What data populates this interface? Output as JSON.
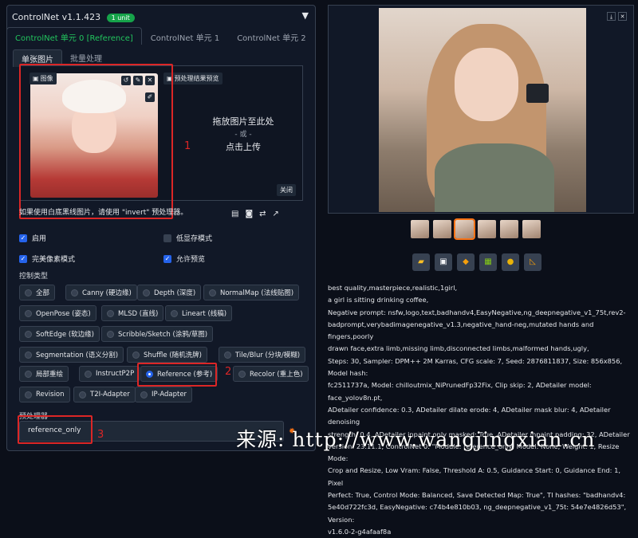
{
  "controlnet": {
    "header_title": "ControlNet v1.1.423",
    "unit_badge": "1 unit",
    "collapse_icon": "▼",
    "tabs": [
      "ControlNet 单元 0 [Reference]",
      "ControlNet 单元 1",
      "ControlNet 单元 2"
    ],
    "subtabs": [
      "单张图片",
      "批量处理"
    ],
    "image_chip_label": "图像",
    "preview_chip_label": "预处理结果预览",
    "drop_line1": "拖放图片至此处",
    "drop_or": "- 或 -",
    "drop_line2": "点击上传",
    "close_label": "关闭",
    "hint": "如果使用白底黑线图片，请使用 \"invert\" 预处理器。",
    "checkboxes": {
      "enable": "启用",
      "low_vram": "低显存模式",
      "pixel_perfect": "完美像素模式",
      "allow_preview": "允许预览"
    },
    "control_type_label": "控制类型",
    "control_types": [
      "全部",
      "Canny (硬边缘)",
      "Depth (深度)",
      "NormalMap (法线贴图)",
      "OpenPose (姿态)",
      "MLSD (直线)",
      "Lineart (线稿)",
      "SoftEdge (软边缘)",
      "Scribble/Sketch (涂鸦/草图)",
      "Segmentation (语义分割)",
      "Shuffle (随机洗牌)",
      "Tile/Blur (分块/模糊)",
      "局部重绘",
      "InstructP2P",
      "Reference (参考)",
      "Recolor (重上色)",
      "Revision",
      "T2I-Adapter",
      "IP-Adapter"
    ],
    "selected_control_type": "Reference (参考)",
    "preprocessor_label": "预处理器",
    "preprocessor_value": "reference_only",
    "annotations": [
      "1",
      "2",
      "3"
    ]
  },
  "output": {
    "info_lines": [
      "best quality,masterpiece,realistic,1girl,",
      "a girl is sitting drinking coffee,",
      "Negative prompt: nsfw,logo,text,badhandv4,EasyNegative,ng_deepnegative_v1_75t,rev2-",
      "badprompt,verybadimagenegative_v1.3,negative_hand-neg,mutated hands and fingers,poorly",
      "drawn face,extra limb,missing limb,disconnected limbs,malformed hands,ugly,",
      "Steps: 30, Sampler: DPM++ 2M Karras, CFG scale: 7, Seed: 2876811837, Size: 856x856, Model hash:",
      "fc2511737a, Model: chilloutmix_NiPrunedFp32Fix, Clip skip: 2, ADetailer model: face_yolov8n.pt,",
      "ADetailer confidence: 0.3, ADetailer dilate erode: 4, ADetailer mask blur: 4, ADetailer denoising",
      "strength: 0.4, ADetailer inpaint only masked: True, ADetailer inpaint padding: 32, ADetailer",
      "version: 23.11.1, ControlNet 0: \"Module: reference_only, Model: None, Weight: 1, Resize Mode:",
      "Crop and Resize, Low Vram: False, Threshold A: 0.5, Guidance Start: 0, Guidance End: 1, Pixel",
      "Perfect: True, Control Mode: Balanced, Save Detected Map: True\", TI hashes: \"badhandv4:",
      "5e40d722fc3d, EasyNegative: c74b4e810b03, ng_deepnegative_v1_75t: 54e7e4826d53\", Version:",
      "v1.6.0-2-g4afaaf8a"
    ]
  },
  "watermark": "来源: http://www.wangjingxian.cn"
}
